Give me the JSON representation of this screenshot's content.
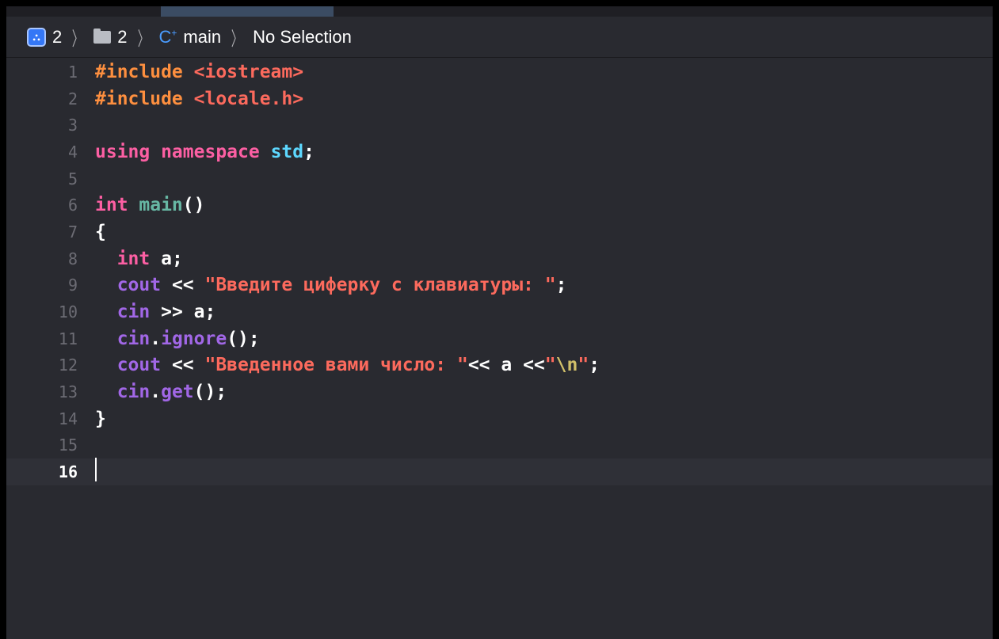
{
  "jumpbar": {
    "project": "2",
    "folder": "2",
    "file": "main",
    "selection": "No Selection"
  },
  "icons": {
    "project": "xcode-project-icon",
    "folder": "folder-icon",
    "file": "cpp-file-icon"
  },
  "colors": {
    "background": "#292a30",
    "preprocessor": "#fd8f3f",
    "keyword": "#fc5fa3",
    "type": "#5dd8ff",
    "function": "#67b7a4",
    "library": "#a167e6",
    "string": "#fc6a5d",
    "escape": "#d0bf69"
  },
  "current_line": 16,
  "lines": [
    {
      "n": "1",
      "tokens": [
        {
          "t": "#include ",
          "c": "pp"
        },
        {
          "t": "<iostream>",
          "c": "str"
        }
      ]
    },
    {
      "n": "2",
      "tokens": [
        {
          "t": "#include ",
          "c": "pp"
        },
        {
          "t": "<locale.h>",
          "c": "str"
        }
      ]
    },
    {
      "n": "3",
      "tokens": []
    },
    {
      "n": "4",
      "tokens": [
        {
          "t": "using namespace ",
          "c": "kw"
        },
        {
          "t": "std",
          "c": "ty"
        },
        {
          "t": ";",
          "c": "plain"
        }
      ]
    },
    {
      "n": "5",
      "tokens": []
    },
    {
      "n": "6",
      "tokens": [
        {
          "t": "int ",
          "c": "kw"
        },
        {
          "t": "main",
          "c": "fn"
        },
        {
          "t": "()",
          "c": "plain"
        }
      ]
    },
    {
      "n": "7",
      "tokens": [
        {
          "t": "{",
          "c": "plain"
        }
      ]
    },
    {
      "n": "8",
      "tokens": [
        {
          "t": "  ",
          "c": "plain"
        },
        {
          "t": "int",
          "c": "kw"
        },
        {
          "t": " a;",
          "c": "plain"
        }
      ]
    },
    {
      "n": "9",
      "tokens": [
        {
          "t": "  ",
          "c": "plain"
        },
        {
          "t": "cout",
          "c": "lib"
        },
        {
          "t": " << ",
          "c": "plain"
        },
        {
          "t": "\"Введите циферку с клавиатуры: \"",
          "c": "str"
        },
        {
          "t": ";",
          "c": "plain"
        }
      ]
    },
    {
      "n": "10",
      "tokens": [
        {
          "t": "  ",
          "c": "plain"
        },
        {
          "t": "cin",
          "c": "lib"
        },
        {
          "t": " >> a;",
          "c": "plain"
        }
      ]
    },
    {
      "n": "11",
      "tokens": [
        {
          "t": "  ",
          "c": "plain"
        },
        {
          "t": "cin",
          "c": "lib"
        },
        {
          "t": ".",
          "c": "plain"
        },
        {
          "t": "ignore",
          "c": "lib"
        },
        {
          "t": "();",
          "c": "plain"
        }
      ]
    },
    {
      "n": "12",
      "tokens": [
        {
          "t": "  ",
          "c": "plain"
        },
        {
          "t": "cout",
          "c": "lib"
        },
        {
          "t": " << ",
          "c": "plain"
        },
        {
          "t": "\"Введенное вами число: \"",
          "c": "str"
        },
        {
          "t": "<< a <<",
          "c": "plain"
        },
        {
          "t": "\"",
          "c": "str"
        },
        {
          "t": "\\n",
          "c": "esc"
        },
        {
          "t": "\"",
          "c": "str"
        },
        {
          "t": ";",
          "c": "plain"
        }
      ]
    },
    {
      "n": "13",
      "tokens": [
        {
          "t": "  ",
          "c": "plain"
        },
        {
          "t": "cin",
          "c": "lib"
        },
        {
          "t": ".",
          "c": "plain"
        },
        {
          "t": "get",
          "c": "lib"
        },
        {
          "t": "();",
          "c": "plain"
        }
      ]
    },
    {
      "n": "14",
      "tokens": [
        {
          "t": "}",
          "c": "plain"
        }
      ]
    },
    {
      "n": "15",
      "tokens": []
    },
    {
      "n": "16",
      "tokens": []
    }
  ]
}
